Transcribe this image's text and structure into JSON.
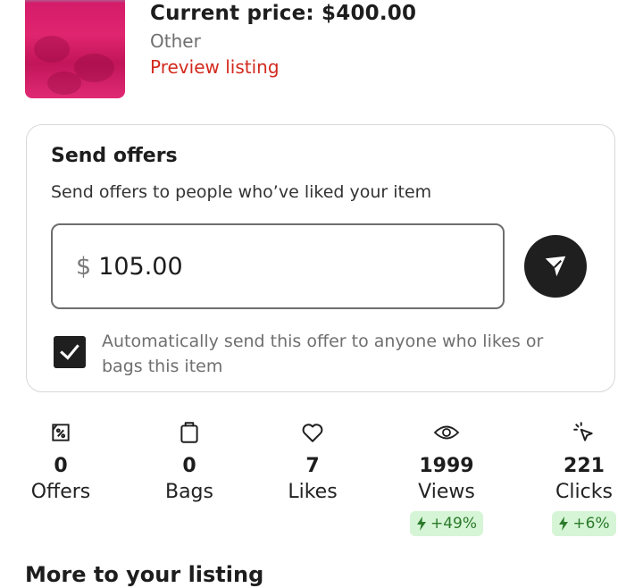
{
  "listing": {
    "current_price": "Current price: $400.00",
    "brand": "Other",
    "preview_link": "Preview listing"
  },
  "send_offers": {
    "title": "Send offers",
    "subtitle": "Send offers to people who’ve liked your item",
    "currency_symbol": "$",
    "offer_value": "105.00",
    "auto_send_checked": true,
    "auto_send_label": "Automatically send this offer to anyone who likes or bags this item"
  },
  "stats": [
    {
      "icon": "offer-percent-icon",
      "value": "0",
      "label": "Offers"
    },
    {
      "icon": "bag-icon",
      "value": "0",
      "label": "Bags"
    },
    {
      "icon": "heart-icon",
      "value": "7",
      "label": "Likes"
    },
    {
      "icon": "eye-icon",
      "value": "1999",
      "label": "Views",
      "change": "+49%"
    },
    {
      "icon": "cursor-click-icon",
      "value": "221",
      "label": "Clicks",
      "change": "+6%"
    }
  ],
  "next_section": {
    "heading": "More to your listing"
  },
  "colors": {
    "accent_red": "#d22a1e",
    "badge_bg": "#d6f5d6",
    "badge_text": "#2b7a2b",
    "dark": "#1f1f1f"
  }
}
